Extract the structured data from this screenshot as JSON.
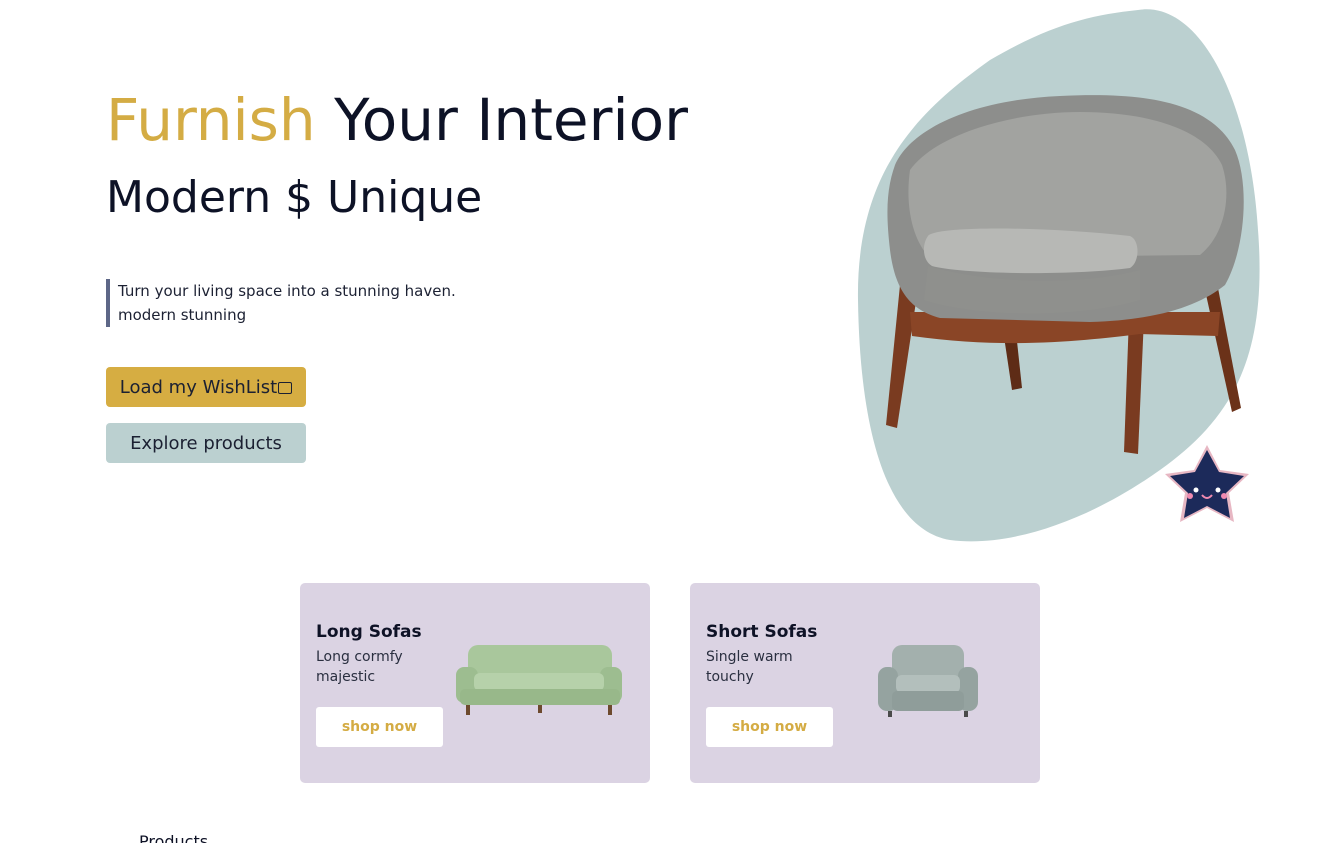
{
  "hero": {
    "title_accent": "Furnish",
    "title_rest": " Your Interior",
    "subtitle": "Modern $ Unique",
    "quote_line1": "Turn your living space into a stunning haven.",
    "quote_line2": "modern stunning"
  },
  "buttons": {
    "wishlist": "Load my WishList",
    "explore": "Explore products"
  },
  "cards": [
    {
      "title": "Long Sofas",
      "description": "Long cormfy majestic",
      "cta": "shop now"
    },
    {
      "title": "Short Sofas",
      "description": "Single warm touchy",
      "cta": "shop now"
    }
  ],
  "products": {
    "heading": "Products"
  },
  "colors": {
    "accent": "#d4ac44",
    "blob": "#bbd0d0",
    "card_bg": "#dbd3e3",
    "text": "#0d1226"
  },
  "icons": [
    "shopping-bag-icon",
    "star-mascot-icon"
  ]
}
